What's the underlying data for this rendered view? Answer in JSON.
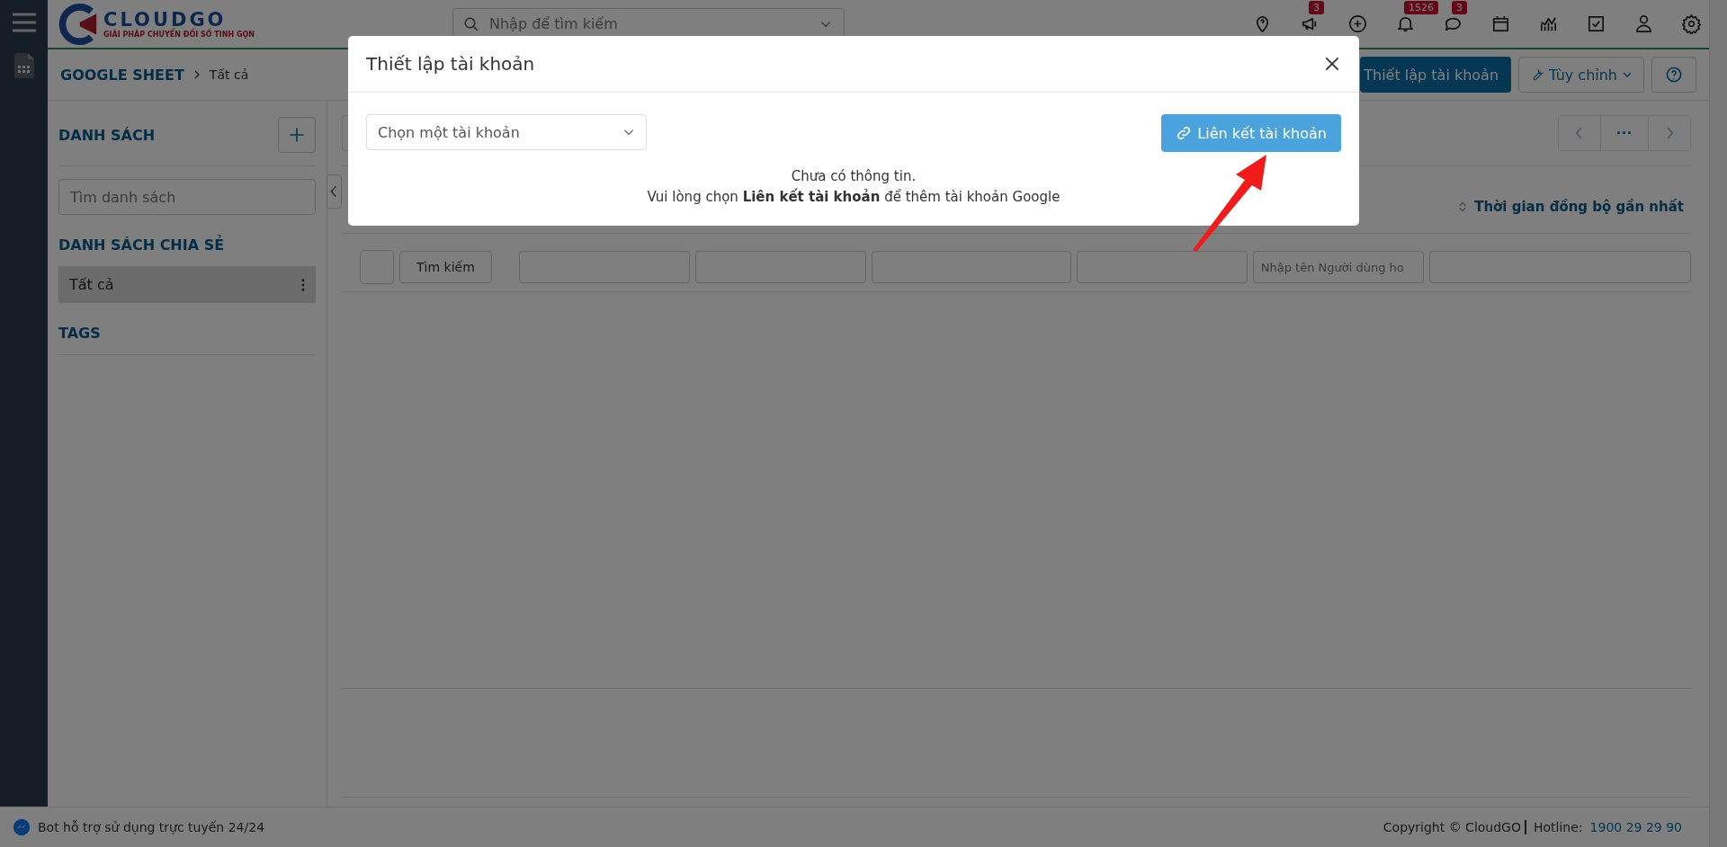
{
  "topbar": {
    "logo_name": "CLOUDGO",
    "logo_tagline": "GIẢI PHÁP CHUYỂN ĐỔI SỐ TINH GỌN",
    "search_placeholder": "Nhập để tìm kiếm",
    "icons": [
      {
        "kind": "pin"
      },
      {
        "kind": "megaphone",
        "badge": "3"
      },
      {
        "kind": "plus"
      },
      {
        "kind": "bell",
        "badge": "1526"
      },
      {
        "kind": "chat",
        "badge": "3"
      },
      {
        "kind": "calendar"
      },
      {
        "kind": "chart"
      },
      {
        "kind": "task"
      },
      {
        "kind": "user"
      },
      {
        "kind": "settings"
      }
    ]
  },
  "breadcrumb": {
    "module": "GOOGLE SHEET",
    "current": "Tất cả"
  },
  "header_buttons": {
    "setup": "Thiết lập tài khoản",
    "customize": "Tùy chỉnh"
  },
  "sidebar": {
    "lists_title": "DANH SÁCH",
    "search_placeholder": "Tìm danh sách",
    "shared_title": "DANH SÁCH CHIA SẺ",
    "shared_items": [
      {
        "label": "Tất cả",
        "selected": true
      }
    ],
    "tags_title": "TAGS"
  },
  "main": {
    "pagination_more": "···",
    "sort_label": "Thời gian đồng bộ gần nhất",
    "filter_button": "Tìm kiếm",
    "user_filter_placeholder": "Nhập tên Người dùng ho"
  },
  "modal": {
    "title": "Thiết lập tài khoản",
    "select_placeholder": "Chọn một tài khoản",
    "link_button": "Liên kết tài khoản",
    "message_line1": "Chưa có thông tin.",
    "message_line2": "Vui lòng chọn **Liên kết tài khoản** để thêm tài khoản Google"
  },
  "footer": {
    "bot_text": "Bot hỗ trợ sử dụng trực tuyến 24/24",
    "copyright": "Copyright © CloudGO",
    "hotline_label": "Hotline:",
    "hotline": "1900 29 29 90"
  }
}
